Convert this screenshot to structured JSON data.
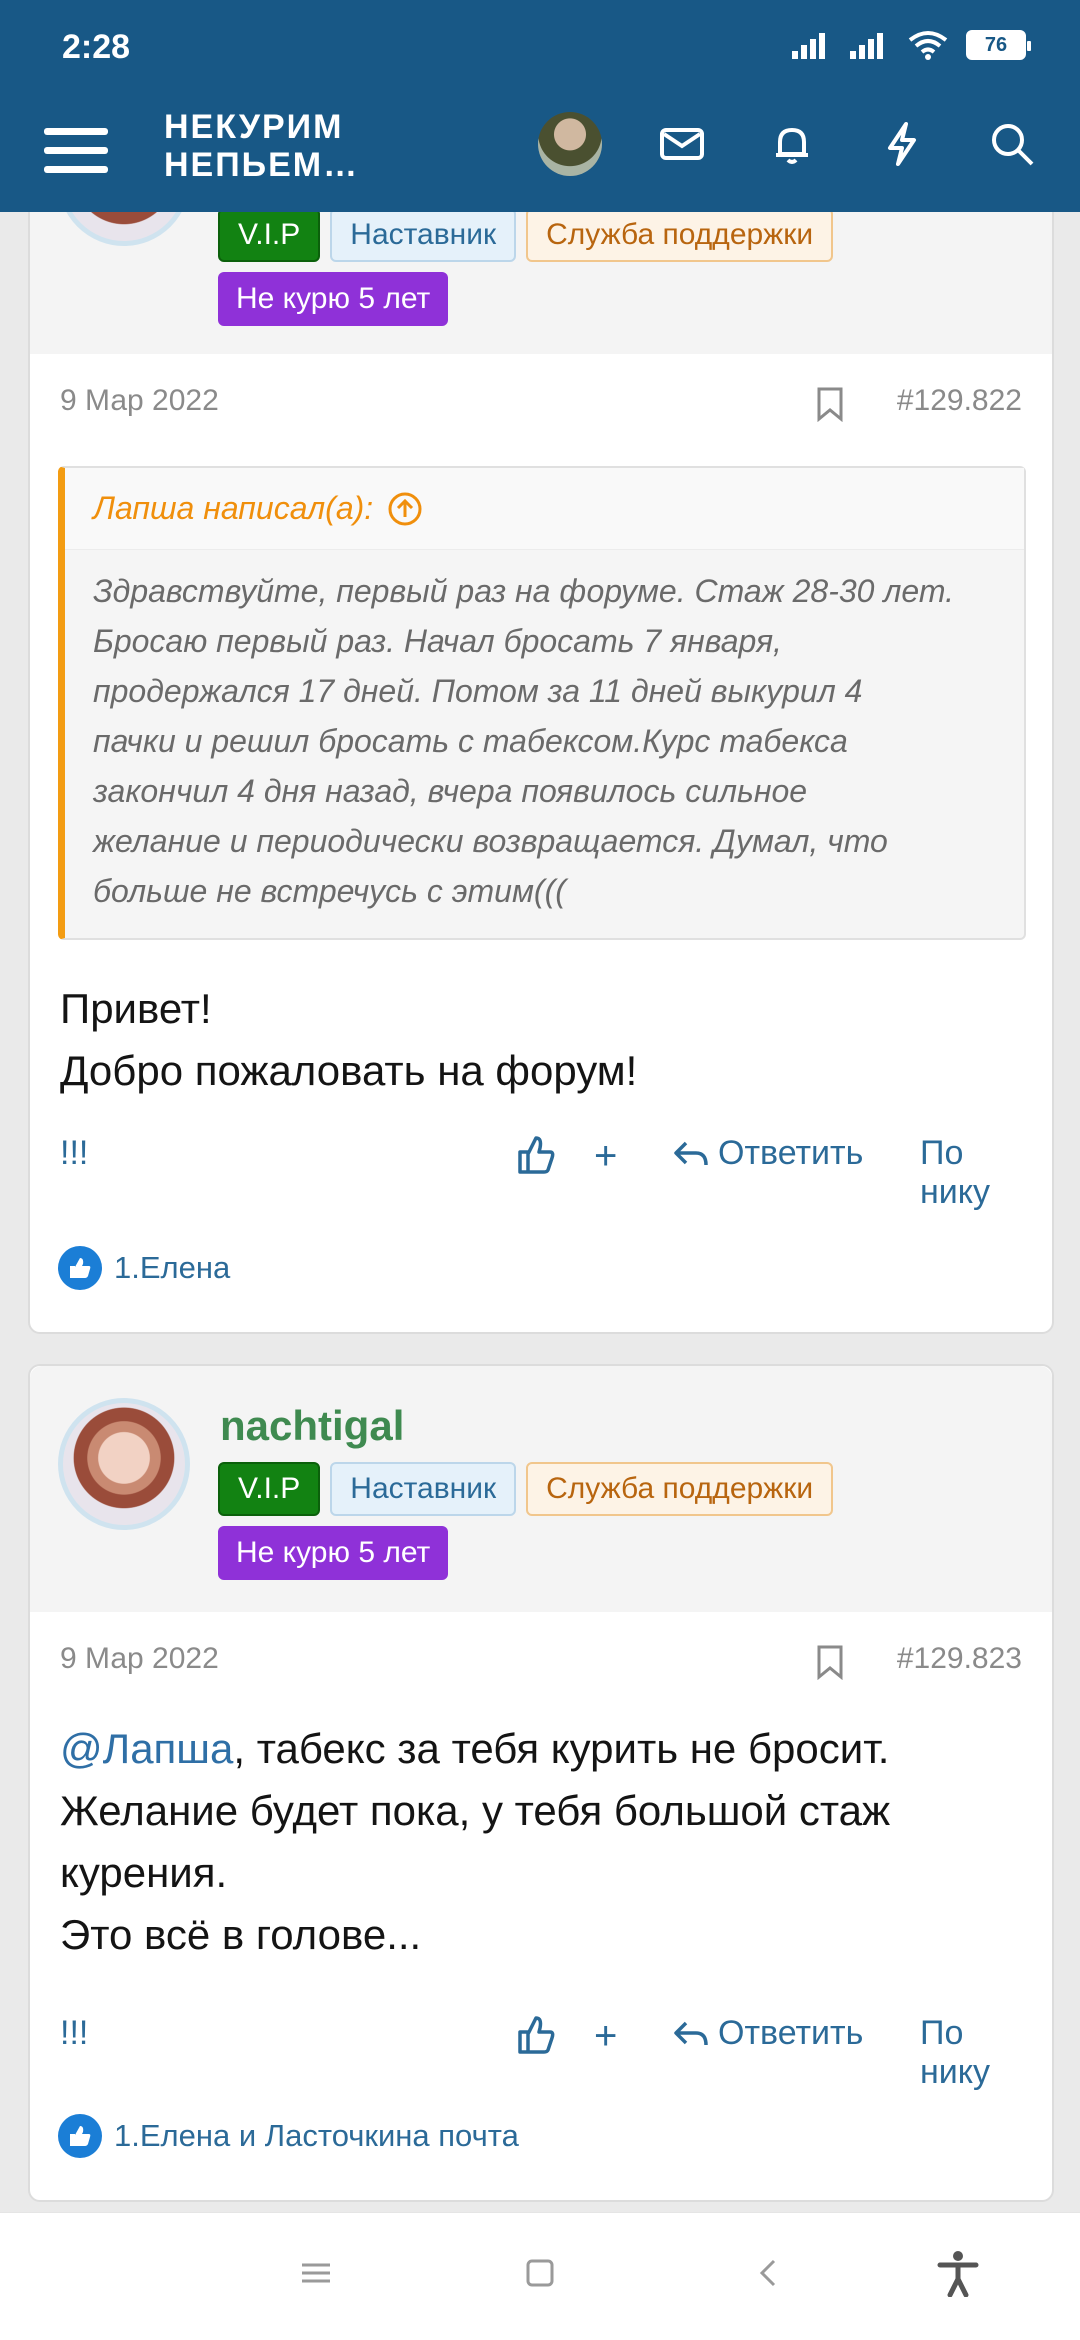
{
  "status": {
    "time": "2:28",
    "battery": "76"
  },
  "header": {
    "logo_line1": "НЕКУРИМ",
    "logo_line2": "НЕПЬЕМ…"
  },
  "posts": [
    {
      "badges": {
        "vip": "V.I.P",
        "mentor": "Наставник",
        "support": "Служба поддержки",
        "years": "Не курю 5 лет"
      },
      "date": "9 Мар 2022",
      "number": "#129.822",
      "quote": {
        "author": "Лапша написал(а):",
        "lines": [
          "Здравствуйте, первый раз на форуме. Стаж 28-30 лет.",
          "Бросаю первый раз. Начал бросать 7 января,",
          "продержался 17 дней. Потом за 11 дней выкурил 4",
          "пачки и решил бросать с табексом.Курс табекса",
          "закончил 4 дня назад, вчера появилось сильное",
          "желание и периодически возвращается. Думал, что",
          "больше не встречусь с этим((("
        ]
      },
      "message": [
        "Привет!",
        "Добро пожаловать на форум!"
      ],
      "actions": {
        "report": "!!!",
        "plus": "+",
        "reply": "Ответить",
        "by_nick": "По нику"
      },
      "likes": "1.Елена"
    },
    {
      "username": "nachtigal",
      "badges": {
        "vip": "V.I.P",
        "mentor": "Наставник",
        "support": "Служба поддержки",
        "years": "Не курю 5 лет"
      },
      "date": "9 Мар 2022",
      "number": "#129.823",
      "message": {
        "mention": "@Лапша",
        "line1_rest": ", табекс за тебя курить не бросит.",
        "line2": "Желание будет пока, у тебя большой стаж",
        "line3": "курения.",
        "line4": "Это всё в голове..."
      },
      "actions": {
        "report": "!!!",
        "plus": "+",
        "reply": "Ответить",
        "by_nick": "По нику"
      },
      "likes": "1.Елена и Ласточкина почта"
    }
  ],
  "colors": {
    "header": "#185886",
    "vip": "#128212",
    "years": "#8f31d8",
    "quote_accent": "#f39c12",
    "link": "#2b6a98",
    "username": "#3f8a50"
  }
}
